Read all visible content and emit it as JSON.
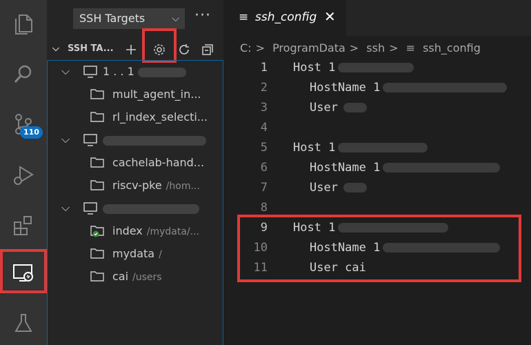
{
  "activity_bar": {
    "source_control_badge": "110"
  },
  "sidebar": {
    "view_selector": "SSH Targets",
    "section_title": "SSH TA...",
    "items": [
      {
        "label": "1 . . 1",
        "desc": ""
      },
      {
        "label": "mult_agent_in...",
        "desc": ""
      },
      {
        "label": "rl_index_selecti...",
        "desc": ""
      },
      {
        "label": "",
        "desc": ""
      },
      {
        "label": "cachelab-hand...",
        "desc": ""
      },
      {
        "label": "riscv-pke",
        "desc": "/hom..."
      },
      {
        "label": "",
        "desc": ""
      },
      {
        "label": "index",
        "desc": "/mydata/..."
      },
      {
        "label": "mydata",
        "desc": "/"
      },
      {
        "label": "cai",
        "desc": "/users"
      }
    ]
  },
  "editor": {
    "tab_label": "ssh_config",
    "breadcrumb": [
      "C:",
      "ProgramData",
      "ssh",
      "ssh_config"
    ],
    "lines": [
      {
        "n": "1",
        "text": "Host 1"
      },
      {
        "n": "2",
        "text": "HostName 1"
      },
      {
        "n": "3",
        "text": "User"
      },
      {
        "n": "4",
        "text": ""
      },
      {
        "n": "5",
        "text": "Host 1"
      },
      {
        "n": "6",
        "text": "HostName 1"
      },
      {
        "n": "7",
        "text": "User"
      },
      {
        "n": "8",
        "text": ""
      },
      {
        "n": "9",
        "text": "Host 1"
      },
      {
        "n": "10",
        "text": "HostName 1"
      },
      {
        "n": "11",
        "text": "User cai"
      }
    ]
  },
  "colors": {
    "highlight": "#e03a3a",
    "badge": "#0e70c0"
  }
}
